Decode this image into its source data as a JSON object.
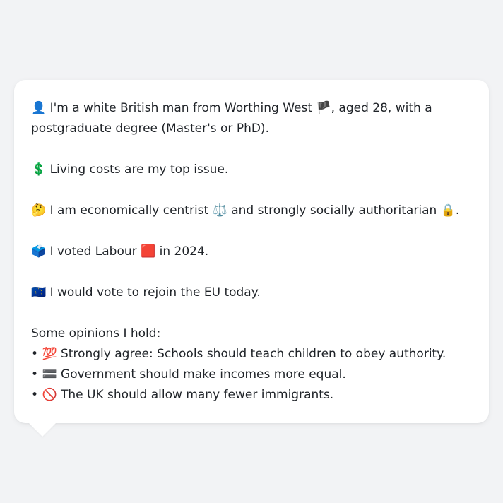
{
  "message": {
    "profile": {
      "icon": "👤",
      "text_before_flag": "I'm a white British man from Worthing West",
      "flag": "🏴",
      "text_after_flag": ", aged 28, with a postgraduate degree (Master's or PhD)."
    },
    "issue": {
      "icon": "💲",
      "text": "Living costs are my top issue."
    },
    "ideology": {
      "icon": "🤔",
      "text_1": "I am economically centrist",
      "icon_2": "⚖️",
      "text_2": "and strongly socially authoritarian",
      "icon_3": "🔒",
      "text_3": "."
    },
    "vote": {
      "icon": "🗳️",
      "text_1": "I voted Labour",
      "icon_2": "🟥",
      "text_2": "in 2024."
    },
    "eu": {
      "icon": "🇪🇺",
      "text": "I would vote to rejoin the EU today."
    },
    "opinions_heading": "Some opinions I hold:",
    "opinions": [
      {
        "bullet": "•",
        "icon": "💯",
        "text": "Strongly agree: Schools should teach children to obey authority."
      },
      {
        "bullet": "•",
        "icon": "🟰",
        "text": "Government should make incomes more equal."
      },
      {
        "bullet": "•",
        "icon": "🚫",
        "text": "The UK should allow many fewer immigrants."
      }
    ]
  }
}
